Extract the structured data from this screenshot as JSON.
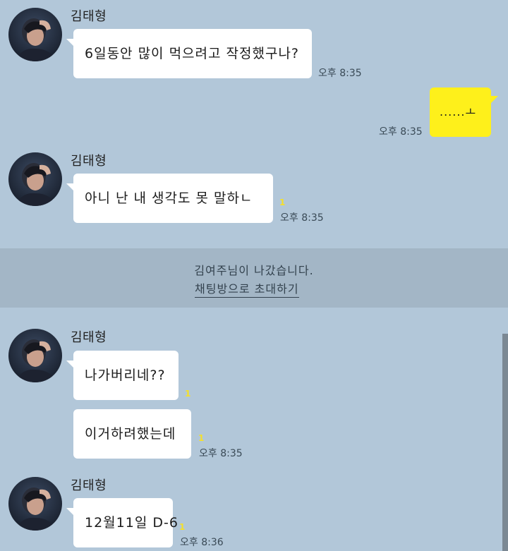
{
  "colors": {
    "chat_bg": "#b2c7d9",
    "notice_bg": "#a3b6c6",
    "bubble_incoming": "#ffffff",
    "bubble_outgoing": "#fef01b",
    "unread_count": "#f5e02a"
  },
  "messages": [
    {
      "sender": "김태형",
      "text": "6일동안 많이 먹으려고 작정했구나?",
      "time": "오후 8:35"
    },
    {
      "text": "......ㅗ",
      "time": "오후 8:35",
      "mine": true
    },
    {
      "sender": "김태형",
      "text": "아니 난 내 생각도 못 말하ㄴ",
      "time": "오후 8:35",
      "unread": "1"
    },
    {
      "sender": "김태형",
      "text": "나가버리네??",
      "unread": "1"
    },
    {
      "text": "이거하려했는데",
      "time": "오후 8:35",
      "unread": "1"
    },
    {
      "sender": "김태형",
      "text": "12월11일 D-6",
      "time": "오후 8:36",
      "unread": "1"
    }
  ],
  "notice": {
    "text": "김여주님이 나갔습니다.",
    "link": "채팅방으로 초대하기"
  }
}
